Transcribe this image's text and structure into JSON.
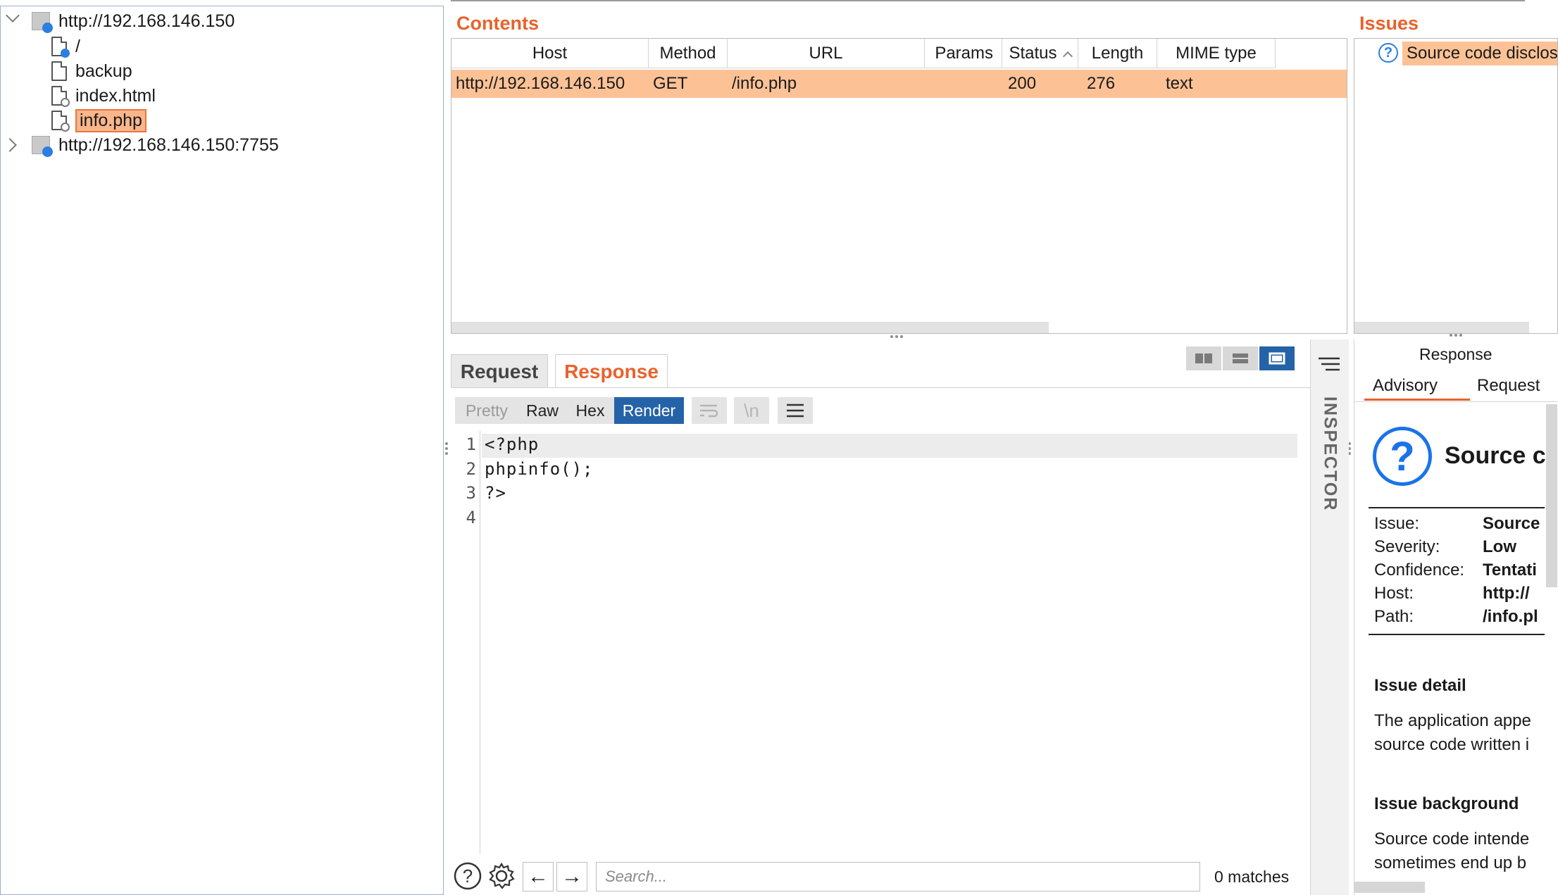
{
  "sitemap": {
    "hosts": [
      {
        "label": "http://192.168.146.150",
        "expanded": true,
        "children": [
          "/",
          "backup",
          "index.html",
          "info.php"
        ]
      },
      {
        "label": "http://192.168.146.150:7755",
        "expanded": false
      }
    ],
    "selected": "info.php"
  },
  "contents": {
    "title": "Contents",
    "columns": [
      "Host",
      "Method",
      "URL",
      "Params",
      "Status",
      "Length",
      "MIME type"
    ],
    "rows": [
      {
        "host": "http://192.168.146.150",
        "method": "GET",
        "url": "/info.php",
        "params": "",
        "status": "200",
        "length": "276",
        "mime": "text"
      }
    ]
  },
  "issues": {
    "title": "Issues",
    "items": [
      "Source code disclos"
    ]
  },
  "message_editor": {
    "tabs": [
      "Request",
      "Response"
    ],
    "active_tab": "Response",
    "views": [
      "Pretty",
      "Raw",
      "Hex",
      "Render"
    ],
    "active_view": "Render",
    "line_numbers": [
      "1",
      "2",
      "3",
      "4"
    ],
    "lines": [
      "<?php",
      "phpinfo();",
      "?>",
      ""
    ],
    "search": {
      "placeholder": "Search...",
      "matches": "0 matches"
    }
  },
  "inspector": {
    "label": "INSPECTOR"
  },
  "advisory": {
    "header": "Response",
    "tabs": [
      "Advisory",
      "Request"
    ],
    "active_tab": "Advisory",
    "title": "Source c",
    "fields": [
      {
        "label": "Issue:",
        "value": "Source"
      },
      {
        "label": "Severity:",
        "value": "Low"
      },
      {
        "label": "Confidence:",
        "value": "Tentati"
      },
      {
        "label": "Host:",
        "value": "http://"
      },
      {
        "label": "Path:",
        "value": "/info.pl"
      }
    ],
    "issue_detail_heading": "Issue detail",
    "issue_detail_lines": [
      "The application appe",
      "source code written i"
    ],
    "issue_background_heading": "Issue background",
    "issue_background_lines": [
      "Source code intende",
      "sometimes end up b"
    ]
  },
  "colors": {
    "accent": "#e8622c",
    "selected_row": "#fcc296",
    "active_button": "#2563a8",
    "node_dot": "#2a7fe0"
  }
}
